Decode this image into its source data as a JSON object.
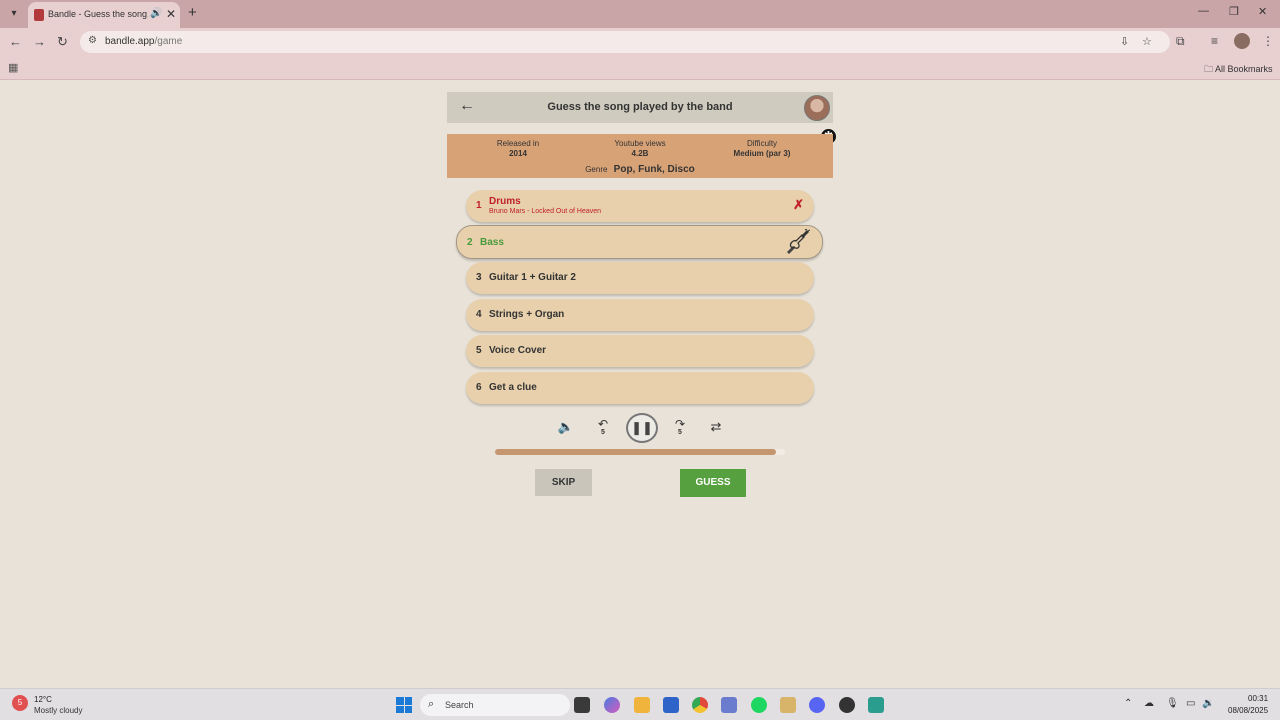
{
  "browser": {
    "tab_title": "Bandle - Guess the song, or",
    "url_host": "bandle.app",
    "url_path": "/game",
    "bookmarks_label": "All Bookmarks"
  },
  "game": {
    "title": "Guess the song played by the band",
    "info": {
      "released_label": "Released in",
      "released_value": "2014",
      "views_label": "Youtube views",
      "views_value": "4.2B",
      "difficulty_label": "Difficulty",
      "difficulty_value": "Medium (par 3)",
      "genre_label": "Genre",
      "genre_value": "Pop, Funk, Disco"
    },
    "clues": [
      {
        "num": "1",
        "label": "Drums",
        "sub": "Bruno Mars - Locked Out of Heaven",
        "state": "wrong"
      },
      {
        "num": "2",
        "label": "Bass",
        "state": "active"
      },
      {
        "num": "3",
        "label": "Guitar 1 + Guitar 2",
        "state": "locked"
      },
      {
        "num": "4",
        "label": "Strings + Organ",
        "state": "locked"
      },
      {
        "num": "5",
        "label": "Voice Cover",
        "state": "locked"
      },
      {
        "num": "6",
        "label": "Get a clue",
        "state": "locked"
      }
    ],
    "controls": {
      "rewind_seconds": "5",
      "forward_seconds": "5"
    },
    "progress": 0.97,
    "skip_label": "SKIP",
    "guess_label": "GUESS",
    "accent_color": "#56a03f",
    "wrong_color": "#c0202a"
  },
  "taskbar": {
    "weather_badge": "5",
    "weather_temp": "12°C",
    "weather_desc": "Mostly cloudy",
    "search_label": "Search",
    "time": "00:31",
    "date": "08/08/2025"
  }
}
